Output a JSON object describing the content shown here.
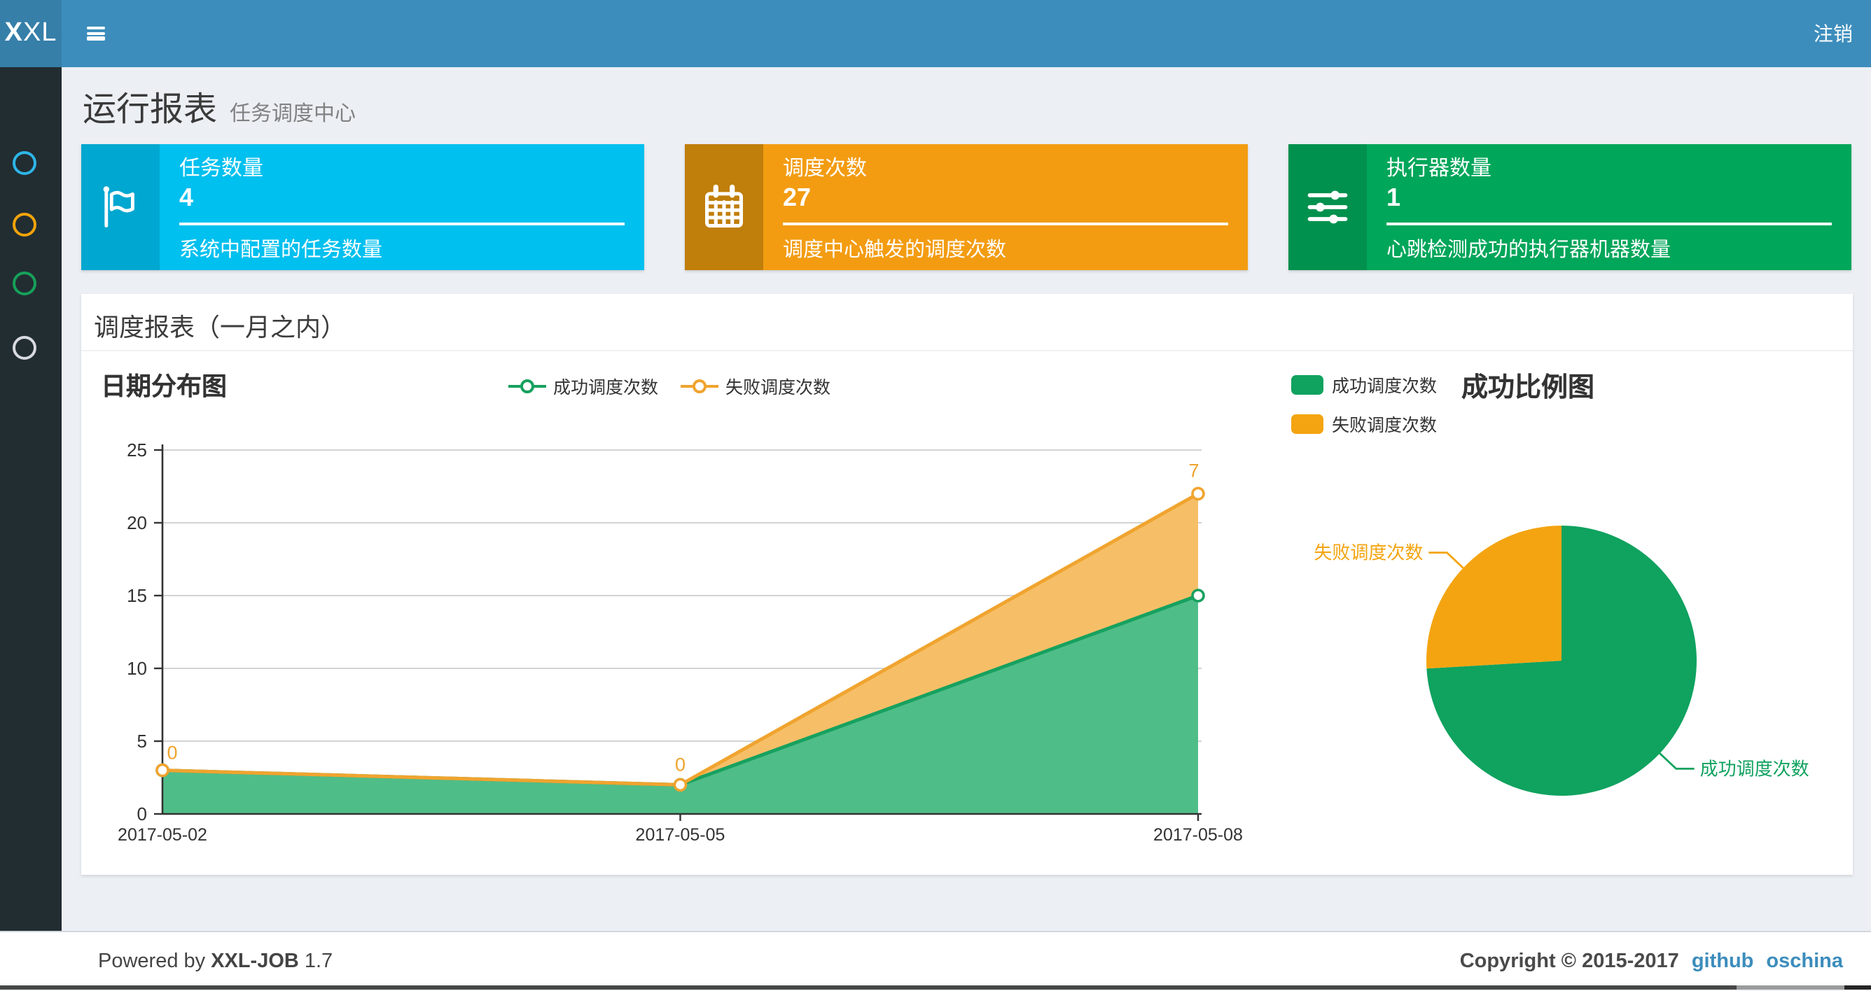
{
  "navbar": {
    "logo": {
      "bold": "X",
      "rest": "XL"
    },
    "logout_label": "注销"
  },
  "sidebar": {
    "items": [
      {
        "icon": "circle-outline-icon",
        "color": "#2EB5E8"
      },
      {
        "icon": "circle-outline-icon",
        "color": "#F0A30A"
      },
      {
        "icon": "circle-outline-icon",
        "color": "#16A05A"
      },
      {
        "icon": "circle-outline-icon",
        "color": "#D7DADE"
      }
    ]
  },
  "header": {
    "title": "运行报表",
    "subtitle": "任务调度中心"
  },
  "info_boxes": [
    {
      "label": "任务数量",
      "value": "4",
      "description": "系统中配置的任务数量",
      "color": "#00C0EF",
      "icon": "flag-icon"
    },
    {
      "label": "调度次数",
      "value": "27",
      "description": "调度中心触发的调度次数",
      "color": "#F39C12",
      "icon": "calendar-icon"
    },
    {
      "label": "执行器数量",
      "value": "1",
      "description": "心跳检测成功的执行器机器数量",
      "color": "#00A65A",
      "icon": "sliders-icon"
    }
  ],
  "panel": {
    "title": "调度报表（一月之内）"
  },
  "chart_data": [
    {
      "type": "area",
      "title": "日期分布图",
      "stacked": true,
      "categories": [
        "2017-05-02",
        "2017-05-05",
        "2017-05-08"
      ],
      "series": [
        {
          "name": "成功调度次数",
          "values": [
            3,
            2,
            15
          ],
          "color": "#17A15F",
          "area_color": "#4FBD88"
        },
        {
          "name": "失败调度次数",
          "values": [
            0,
            0,
            7
          ],
          "color": "#F0A42F",
          "area_color": "#F6BF67"
        }
      ],
      "point_labels": [
        0,
        0,
        7
      ],
      "ylim": [
        0,
        25
      ],
      "yticks": [
        0,
        5,
        10,
        15,
        20,
        25
      ],
      "grid": true,
      "legend_position": "top-center"
    },
    {
      "type": "pie",
      "title": "成功比例图",
      "start_angle": 90,
      "slices": [
        {
          "name": "成功调度次数",
          "value": 20,
          "color": "#10A25F"
        },
        {
          "name": "失败调度次数",
          "value": 7,
          "color": "#F4A411"
        }
      ],
      "legend_position": "top-left"
    }
  ],
  "footer": {
    "powered_prefix": "Powered by",
    "product": "XXL-JOB",
    "version": "1.7",
    "copyright": "Copyright © 2015-2017",
    "links": [
      {
        "label": "github"
      },
      {
        "label": "oschina"
      }
    ],
    "link_color": "#3C8DBC"
  },
  "colors": {
    "navbar": "#3C8DBC",
    "logo_bg": "#367FA9",
    "sidebar_bg": "#222D32",
    "page_bg": "#ECF0F5"
  }
}
